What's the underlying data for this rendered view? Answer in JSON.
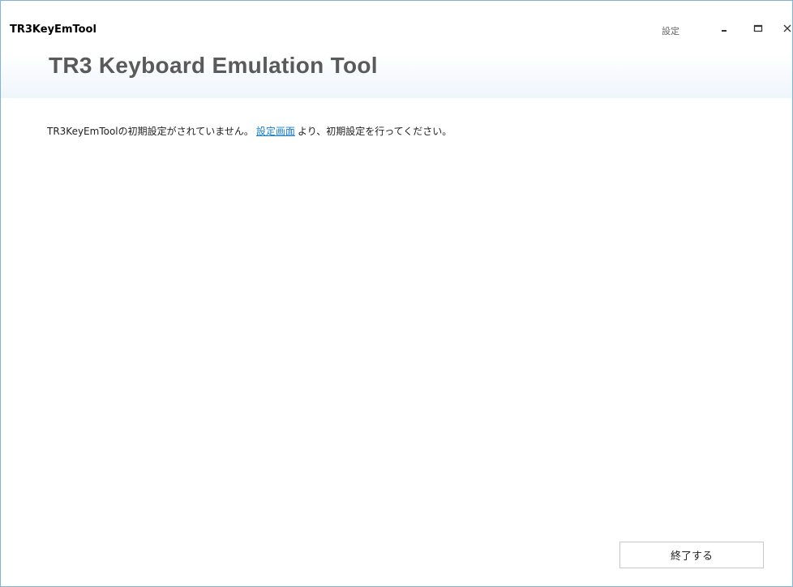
{
  "window": {
    "app_title": "TR3KeyEmTool",
    "settings_label": "設定",
    "header_title": "TR3 Keyboard Emulation Tool",
    "minimize_icon": "minimize-icon",
    "maximize_icon": "maximize-icon",
    "close_icon": "close-icon"
  },
  "main": {
    "message_before": "TR3KeyEmToolの初期設定がされていません。",
    "message_link": "設定画面",
    "message_after": "より、初期設定を行ってください。"
  },
  "footer": {
    "exit_label": "終了する"
  },
  "colors": {
    "link": "#1a7fc9",
    "border": "#7fb3d9",
    "header_text": "#5a5a5a"
  }
}
